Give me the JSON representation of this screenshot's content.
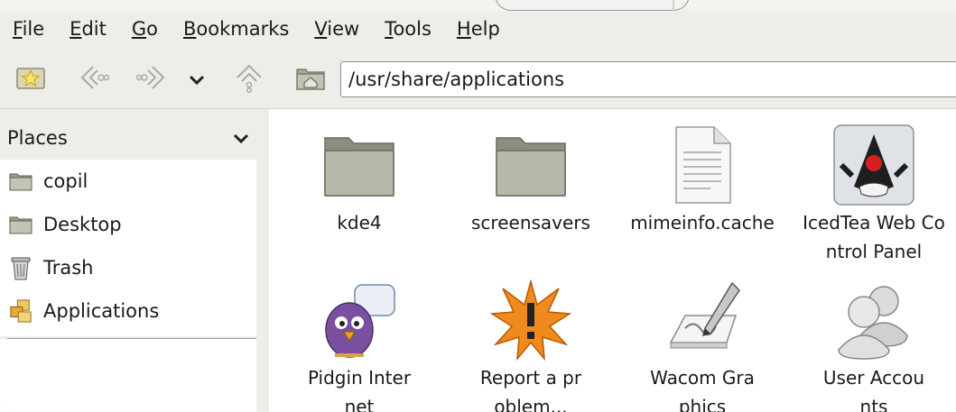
{
  "menubar": {
    "items": [
      {
        "mnemonic": "F",
        "rest": "ile"
      },
      {
        "mnemonic": "E",
        "rest": "dit"
      },
      {
        "mnemonic": "G",
        "rest": "o"
      },
      {
        "mnemonic": "B",
        "rest": "ookmarks"
      },
      {
        "mnemonic": "V",
        "rest": "iew"
      },
      {
        "mnemonic": "T",
        "rest": "ools"
      },
      {
        "mnemonic": "H",
        "rest": "elp"
      }
    ]
  },
  "toolbar": {
    "location": "/usr/share/applications",
    "icons": [
      "new-bookmark-icon",
      "back-icon",
      "forward-icon",
      "chevron-down-icon",
      "up-icon",
      "home-folder-icon"
    ]
  },
  "sidebar": {
    "title": "Places",
    "items": [
      {
        "label": "copil",
        "icon": "folder-icon"
      },
      {
        "label": "Desktop",
        "icon": "folder-icon"
      },
      {
        "label": "Trash",
        "icon": "trash-icon"
      },
      {
        "label": "Applications",
        "icon": "applications-icon"
      }
    ]
  },
  "files": [
    {
      "label": "kde4",
      "icon": "folder-icon"
    },
    {
      "label": "screensavers",
      "icon": "folder-icon"
    },
    {
      "label": "mimeinfo.cache",
      "icon": "text-file-icon"
    },
    {
      "label": "IcedTea Web Control Panel",
      "icon": "java-duke-icon"
    },
    {
      "label": "Pidgin Internet",
      "icon": "pidgin-icon"
    },
    {
      "label": "Report a problem...",
      "icon": "warning-burst-icon"
    },
    {
      "label": "Wacom Graphics",
      "icon": "tablet-pen-icon"
    },
    {
      "label": "User Accounts",
      "icon": "users-icon"
    }
  ],
  "colors": {
    "window_bg": "#efedea",
    "view_bg": "#ffffff",
    "folder": "#b8b8a8"
  }
}
